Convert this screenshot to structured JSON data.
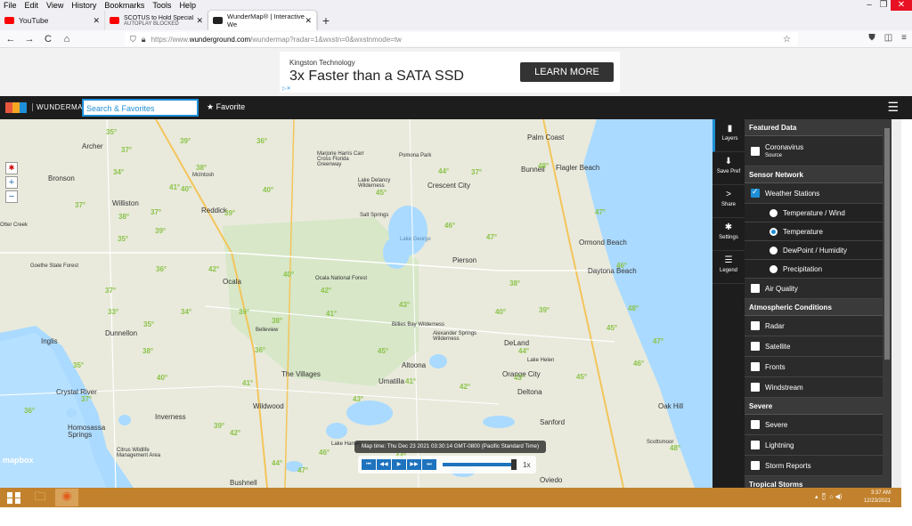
{
  "menu": [
    "File",
    "Edit",
    "View",
    "History",
    "Bookmarks",
    "Tools",
    "Help"
  ],
  "window_controls": {
    "minimize": "–",
    "maximize": "❐",
    "close": "✕"
  },
  "tabs": [
    {
      "title": "YouTube",
      "close": "✕",
      "sub": ""
    },
    {
      "title": "SCOTUS to Hold Special Sessi",
      "close": "✕",
      "sub": "AUTOPLAY BLOCKED"
    },
    {
      "title": "WunderMap® | Interactive We",
      "close": "✕",
      "sub": ""
    }
  ],
  "new_tab": "+",
  "nav": {
    "back": "←",
    "forward": "→",
    "reload": "C",
    "home": "⌂"
  },
  "url": {
    "prefix": "https://www.",
    "domain": "wunderground.com",
    "path": "/wundermap?radar=1&wxstn=0&wxstnmode=tw"
  },
  "ad": {
    "brand": "Kingston Technology",
    "headline": "3x Faster than a SATA SSD",
    "cta": "LEARN MORE"
  },
  "wu": {
    "name": "WUNDERMAP",
    "search_placeholder": "Search & Favorites",
    "favorite": "Favorite",
    "menu": "☰"
  },
  "map": {
    "attribution": "mapbox",
    "time_label": "Map time: Thu Dec 23 2021 03:30:14 GMT-0800 (Pacific Standard Time)",
    "speed": "1x",
    "places": [
      "Archer",
      "Bronson",
      "Williston",
      "Reddick",
      "Ocala",
      "Dunnellon",
      "Inglis",
      "Crystal River",
      "Inverness",
      "Homosassa Springs",
      "Citrus Wildlife Management Area",
      "Bushnell",
      "Wildwood",
      "The Villages",
      "Umatilla",
      "Altoona",
      "Pierson",
      "DeLand",
      "Orange City",
      "Deltona",
      "Sanford",
      "Oviedo",
      "Oak Hill",
      "Scottsmoor",
      "Daytona Beach",
      "Ormond Beach",
      "Flagler Beach",
      "Palm Coast",
      "Bunnell",
      "Crescent City",
      "Salt Springs",
      "Lake George",
      "Ocala National Forest",
      "Belleview",
      "Goethe State Forest",
      "Otter Creek",
      "Lake Helen",
      "McIntosh",
      "Pomona Park",
      "Marjorie Harris Carr Cross Florida Greenway",
      "Lake Delancy Wilderness",
      "Billies Bay Wilderness",
      "Alexander Springs Wilderness",
      "Lake Harney"
    ],
    "temps": [
      "35°",
      "37°",
      "39°",
      "40°",
      "38°",
      "34°",
      "36°",
      "39°",
      "37°",
      "38°",
      "35°",
      "37°",
      "41°",
      "39°",
      "40°",
      "42°",
      "36°",
      "37°",
      "33°",
      "34°",
      "35°",
      "36°",
      "38°",
      "39°",
      "40°",
      "42°",
      "41°",
      "43°",
      "44°",
      "45°",
      "46°",
      "47°",
      "48°",
      "37°",
      "38°",
      "40°",
      "39°",
      "42°",
      "45°",
      "44°",
      "43°",
      "41°",
      "46°",
      "47°",
      "45°",
      "44°",
      "42°",
      "39°",
      "37°",
      "36°",
      "35°",
      "38°",
      "40°",
      "41°",
      "43°",
      "44°",
      "45°",
      "46°",
      "47°",
      "48°",
      "48°",
      "47°",
      "46°"
    ]
  },
  "tools": [
    {
      "icon": "layers-icon",
      "glyph": "▮",
      "label": "Layers"
    },
    {
      "icon": "save-icon",
      "glyph": "⬇",
      "label": "Save Pref"
    },
    {
      "icon": "share-icon",
      "glyph": ">",
      "label": "Share"
    },
    {
      "icon": "settings-icon",
      "glyph": "✱",
      "label": "Settings"
    },
    {
      "icon": "legend-icon",
      "glyph": "☰",
      "label": "Legend"
    }
  ],
  "panel": {
    "featured": {
      "header": "Featured Data",
      "coronavirus": "Coronavirus",
      "source": "Source"
    },
    "sensor": {
      "header": "Sensor Network",
      "weather_stations": "Weather Stations",
      "temp_wind": "Temperature / Wind",
      "temperature": "Temperature",
      "dewpoint": "DewPoint / Humidity",
      "precip": "Precipitation",
      "air_quality": "Air Quality"
    },
    "atmospheric": {
      "header": "Atmospheric Conditions",
      "radar": "Radar",
      "satellite": "Satellite",
      "fronts": "Fronts",
      "windstream": "Windstream"
    },
    "severe": {
      "header": "Severe",
      "severe": "Severe",
      "lightning": "Lightning",
      "storm_reports": "Storm Reports"
    },
    "tropical": {
      "header": "Tropical Storms"
    }
  },
  "taskbar": {
    "time": "3:37 AM",
    "date": "12/23/2021"
  },
  "colors": {
    "accent": "#1e8ed6",
    "temp_green": "#8bc34a",
    "taskbar": "#c2822d"
  }
}
